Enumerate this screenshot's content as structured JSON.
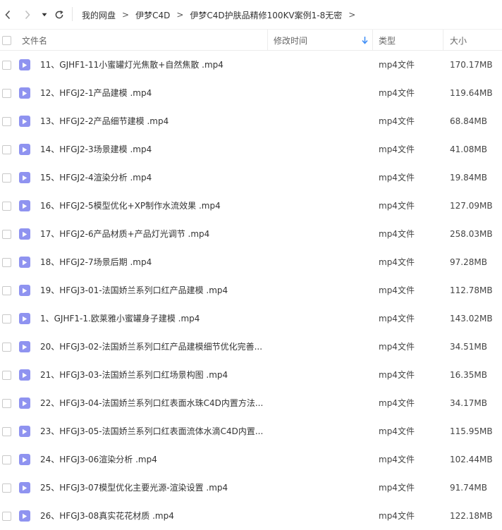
{
  "nav": {
    "back_icon": "chevron-left-icon",
    "forward_icon": "chevron-right-icon",
    "history_icon": "caret-down-icon",
    "refresh_icon": "refresh-icon"
  },
  "breadcrumb": [
    {
      "label": "我的网盘"
    },
    {
      "label": "伊梦C4D"
    },
    {
      "label": "伊梦C4D护肤品精修100KV案例1-8无密"
    }
  ],
  "breadcrumb_separator": ">",
  "columns": {
    "name": "文件名",
    "modified": "修改时间",
    "type": "类型",
    "size": "大小"
  },
  "colors": {
    "accent": "#3b8cf6",
    "file_icon": "#8f93f0"
  },
  "files": [
    {
      "name": "11、GJHF1-11小蜜罐灯光焦散+自然焦散 .mp4",
      "type": "mp4文件",
      "size": "170.17MB"
    },
    {
      "name": "12、HFGJ2-1产品建模 .mp4",
      "type": "mp4文件",
      "size": "119.64MB"
    },
    {
      "name": "13、HFGJ2-2产品细节建模 .mp4",
      "type": "mp4文件",
      "size": "68.84MB"
    },
    {
      "name": "14、HFGJ2-3场景建模 .mp4",
      "type": "mp4文件",
      "size": "41.08MB"
    },
    {
      "name": "15、HFGJ2-4渲染分析 .mp4",
      "type": "mp4文件",
      "size": "19.84MB"
    },
    {
      "name": "16、HFGJ2-5模型优化+XP制作水流效果 .mp4",
      "type": "mp4文件",
      "size": "127.09MB"
    },
    {
      "name": "17、HFGJ2-6产品材质+产品灯光调节 .mp4",
      "type": "mp4文件",
      "size": "258.03MB"
    },
    {
      "name": "18、HFGJ2-7场景后期 .mp4",
      "type": "mp4文件",
      "size": "97.28MB"
    },
    {
      "name": "19、HFGJ3-01-法国娇兰系列口红产品建模 .mp4",
      "type": "mp4文件",
      "size": "112.78MB"
    },
    {
      "name": "1、GJHF1-1.欧莱雅小蜜罐身子建模 .mp4",
      "type": "mp4文件",
      "size": "143.02MB"
    },
    {
      "name": "20、HFGJ3-02-法国娇兰系列口红产品建模细节优化完善...",
      "type": "mp4文件",
      "size": "34.51MB"
    },
    {
      "name": "21、HFGJ3-03-法国娇兰系列口红场景构图 .mp4",
      "type": "mp4文件",
      "size": "16.35MB"
    },
    {
      "name": "22、HFGJ3-04-法国娇兰系列口红表面水珠C4D内置方法...",
      "type": "mp4文件",
      "size": "34.17MB"
    },
    {
      "name": "23、HFGJ3-05-法国娇兰系列口红表面流体水滴C4D内置...",
      "type": "mp4文件",
      "size": "115.95MB"
    },
    {
      "name": "24、HFGJ3-06渲染分析 .mp4",
      "type": "mp4文件",
      "size": "102.44MB"
    },
    {
      "name": "25、HFGJ3-07模型优化主要光源-渲染设置 .mp4",
      "type": "mp4文件",
      "size": "91.74MB"
    },
    {
      "name": "26、HFGJ3-08真实花花材质 .mp4",
      "type": "mp4文件",
      "size": "122.18MB"
    }
  ]
}
